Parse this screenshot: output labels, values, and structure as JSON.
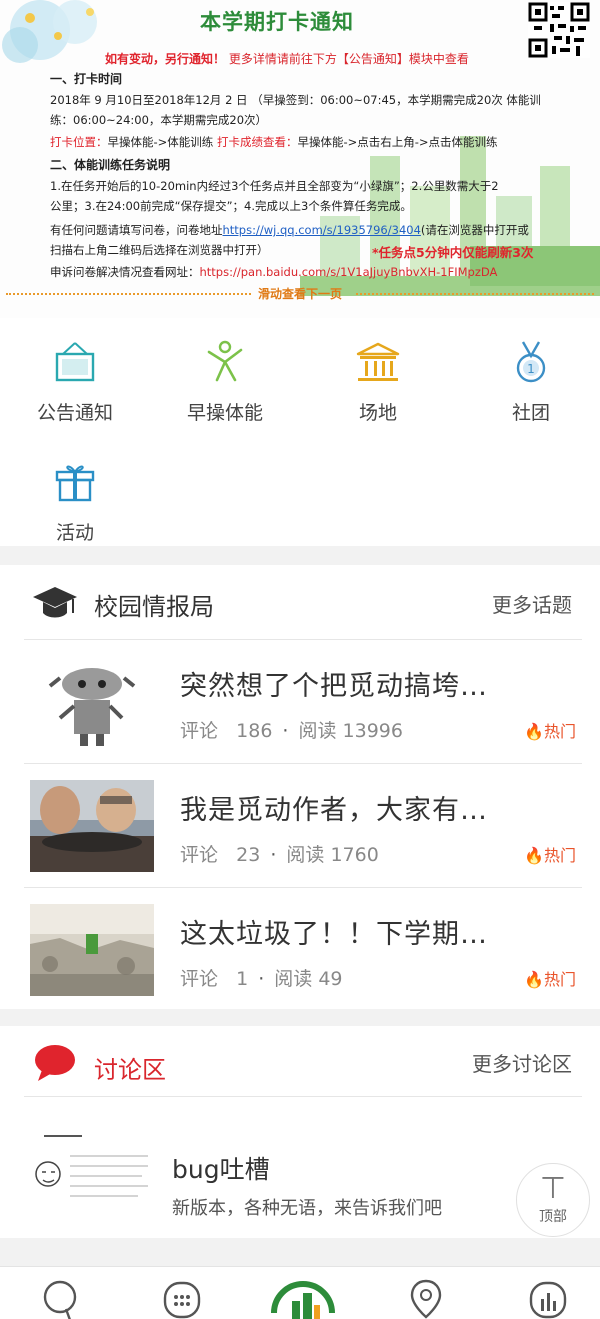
{
  "banner": {
    "title": "本学期打卡通知",
    "subtitle_red": "如有变动，另行通知！",
    "subtitle_more": "更多详情请前往下方【公告通知】模块中查看",
    "sec1_head": "一、打卡时间",
    "sec1_line1": "2018年 9 月10日至2018年12月 2 日 （早操签到：06:00~07:45，本学期需完成20次 体能训",
    "sec1_line2": "练：06:00~24:00，本学期需完成20次）",
    "loc_label": "打卡位置：",
    "loc_text": "早操体能->体能训练 ",
    "score_label": "打卡成绩查看：",
    "score_text": "早操体能->点击右上角->点击体能训练",
    "sec2_head": "二、体能训练任务说明",
    "sec2_line1": "1.在任务开始后的10-20min内经过3个任务点并且全部变为“小绿旗”；2.公里数需大于2",
    "sec2_line2": "公里；3.在24:00前完成“保存提交”；4.完成以上3个条件算任务完成。",
    "q_line1_pre": "有任何问题请填写问卷，问卷地址",
    "q_link": "https://wj.qq.com/s/1935796/3404",
    "q_line1_post": "(请在浏览器中打开或",
    "q_line2": "扫描右上角二维码后选择在浏览器中打开）",
    "refresh_note": "*任务点5分钟内仅能刷新3次",
    "appeal_pre": "申诉问卷解决情况查看网址：",
    "appeal_link": "https://pan.baidu.com/s/1V1aJjuyBnbvXH-1FIMpzDA",
    "scroll_hint": "滑动查看下一页"
  },
  "nav": {
    "items": [
      {
        "label": "公告通知",
        "icon": "notice-board-icon"
      },
      {
        "label": "早操体能",
        "icon": "exercise-person-icon"
      },
      {
        "label": "场地",
        "icon": "building-icon"
      },
      {
        "label": "社团",
        "icon": "medal-icon"
      },
      {
        "label": "活动",
        "icon": "gift-icon"
      }
    ]
  },
  "campus": {
    "title": "校园情报局",
    "more": "更多话题",
    "posts": [
      {
        "title": "突然想了个把觅动搞垮…",
        "comment_label": "评论",
        "comments": "186",
        "read_label": "阅读",
        "reads": "13996",
        "hot": "热门"
      },
      {
        "title": "我是觅动作者，大家有…",
        "comment_label": "评论",
        "comments": "23",
        "read_label": "阅读",
        "reads": "1760",
        "hot": "热门"
      },
      {
        "title": "这太垃圾了！！下学期…",
        "comment_label": "评论",
        "comments": "1",
        "read_label": "阅读",
        "reads": "49",
        "hot": "热门"
      }
    ]
  },
  "discussion": {
    "title": "讨论区",
    "more": "更多讨论区",
    "forum": {
      "name": "bug吐槽",
      "desc": "新版本，各种无语，来告诉我们吧"
    }
  },
  "top_button": {
    "label": "顶部"
  },
  "colors": {
    "accent_green": "#2d8c3a",
    "accent_red": "#d9262d",
    "hot_orange": "#e9542b",
    "icon_teal": "#2aa8b0"
  }
}
